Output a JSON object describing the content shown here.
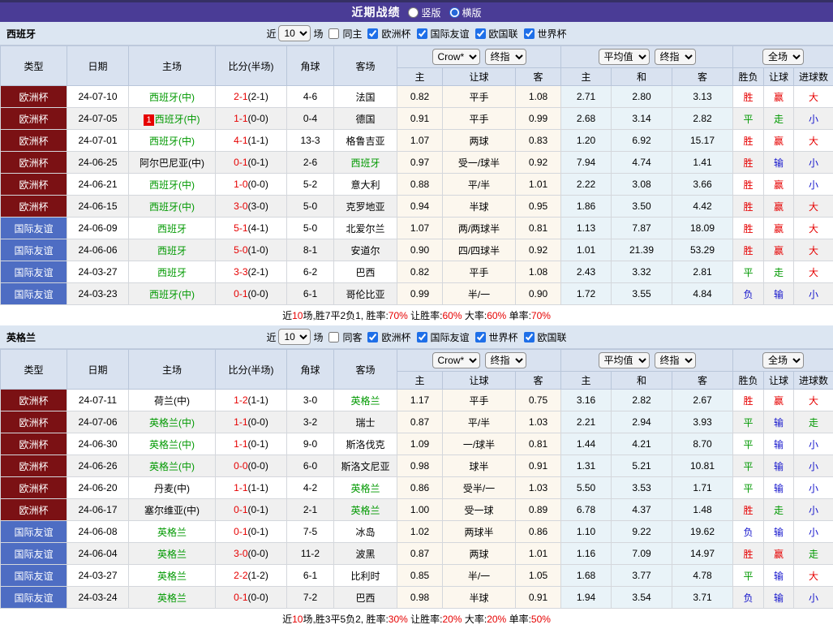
{
  "title_bar": {
    "title": "近期战绩",
    "vertical_label": "竖版",
    "horizontal_label": "横版",
    "selected_layout": "横版"
  },
  "table_header": {
    "main_cols": [
      "类型",
      "日期",
      "主场",
      "比分(半场)",
      "角球",
      "客场"
    ],
    "sub_cols": [
      "主",
      "让球",
      "客",
      "主",
      "和",
      "客",
      "胜负",
      "让球",
      "进球数"
    ],
    "selects": {
      "bookmaker": "Crow*",
      "final_odds_1": "终指",
      "average": "平均值",
      "final_odds_2": "终指",
      "scope": "全场"
    }
  },
  "colors": {
    "titlebar_purple": "#4a3c96",
    "euro_cup_bg": "#7b1114",
    "friendly_bg": "#4e6dc3",
    "win_red": "#e60000",
    "draw_green": "#009900",
    "lose_blue": "#1414cc",
    "crow_cols_bg": "#fcf7ee",
    "avg_cols_bg": "#e9f3f8"
  },
  "sections": [
    {
      "team": "西班牙",
      "filter": {
        "near_label": "近",
        "count": "10",
        "games_label": "场",
        "same_label": "同主",
        "same_checked": false,
        "leagues": [
          "欧洲杯",
          "国际友谊",
          "欧国联",
          "世界杯"
        ]
      },
      "rows": [
        {
          "league": "欧洲杯",
          "lt": "euro",
          "date": "24-07-10",
          "home": "西班牙(中)",
          "hg": 1,
          "badge": "",
          "score": "2-1",
          "half": "(2-1)",
          "corner": "4-6",
          "away": "法国",
          "ag": 0,
          "odds": [
            "0.82",
            "平手",
            "1.08"
          ],
          "avg": [
            "2.71",
            "2.80",
            "3.13"
          ],
          "res": [
            [
              "胜",
              "r"
            ],
            [
              "赢",
              "r"
            ],
            [
              "大",
              "r"
            ]
          ]
        },
        {
          "league": "欧洲杯",
          "lt": "euro",
          "date": "24-07-05",
          "home": "西班牙(中)",
          "hg": 1,
          "badge": "1",
          "score": "1-1",
          "half": "(0-0)",
          "corner": "0-4",
          "away": "德国",
          "ag": 0,
          "odds": [
            "0.91",
            "平手",
            "0.99"
          ],
          "avg": [
            "2.68",
            "3.14",
            "2.82"
          ],
          "res": [
            [
              "平",
              "g"
            ],
            [
              "走",
              "g"
            ],
            [
              "小",
              "b"
            ]
          ]
        },
        {
          "league": "欧洲杯",
          "lt": "euro",
          "date": "24-07-01",
          "home": "西班牙(中)",
          "hg": 1,
          "badge": "",
          "score": "4-1",
          "half": "(1-1)",
          "corner": "13-3",
          "away": "格鲁吉亚",
          "ag": 0,
          "odds": [
            "1.07",
            "两球",
            "0.83"
          ],
          "avg": [
            "1.20",
            "6.92",
            "15.17"
          ],
          "res": [
            [
              "胜",
              "r"
            ],
            [
              "赢",
              "r"
            ],
            [
              "大",
              "r"
            ]
          ]
        },
        {
          "league": "欧洲杯",
          "lt": "euro",
          "date": "24-06-25",
          "home": "阿尔巴尼亚(中)",
          "hg": 0,
          "badge": "",
          "score": "0-1",
          "half": "(0-1)",
          "corner": "2-6",
          "away": "西班牙",
          "ag": 1,
          "odds": [
            "0.97",
            "受一/球半",
            "0.92"
          ],
          "avg": [
            "7.94",
            "4.74",
            "1.41"
          ],
          "res": [
            [
              "胜",
              "r"
            ],
            [
              "输",
              "b"
            ],
            [
              "小",
              "b"
            ]
          ]
        },
        {
          "league": "欧洲杯",
          "lt": "euro",
          "date": "24-06-21",
          "home": "西班牙(中)",
          "hg": 1,
          "badge": "",
          "score": "1-0",
          "half": "(0-0)",
          "corner": "5-2",
          "away": "意大利",
          "ag": 0,
          "odds": [
            "0.88",
            "平/半",
            "1.01"
          ],
          "avg": [
            "2.22",
            "3.08",
            "3.66"
          ],
          "res": [
            [
              "胜",
              "r"
            ],
            [
              "赢",
              "r"
            ],
            [
              "小",
              "b"
            ]
          ]
        },
        {
          "league": "欧洲杯",
          "lt": "euro",
          "date": "24-06-15",
          "home": "西班牙(中)",
          "hg": 1,
          "badge": "",
          "score": "3-0",
          "half": "(3-0)",
          "corner": "5-0",
          "away": "克罗地亚",
          "ag": 0,
          "odds": [
            "0.94",
            "半球",
            "0.95"
          ],
          "avg": [
            "1.86",
            "3.50",
            "4.42"
          ],
          "res": [
            [
              "胜",
              "r"
            ],
            [
              "赢",
              "r"
            ],
            [
              "大",
              "r"
            ]
          ]
        },
        {
          "league": "国际友谊",
          "lt": "friendly",
          "date": "24-06-09",
          "home": "西班牙",
          "hg": 1,
          "badge": "",
          "score": "5-1",
          "half": "(4-1)",
          "corner": "5-0",
          "away": "北爱尔兰",
          "ag": 0,
          "odds": [
            "1.07",
            "两/两球半",
            "0.81"
          ],
          "avg": [
            "1.13",
            "7.87",
            "18.09"
          ],
          "res": [
            [
              "胜",
              "r"
            ],
            [
              "赢",
              "r"
            ],
            [
              "大",
              "r"
            ]
          ]
        },
        {
          "league": "国际友谊",
          "lt": "friendly",
          "date": "24-06-06",
          "home": "西班牙",
          "hg": 1,
          "badge": "",
          "score": "5-0",
          "half": "(1-0)",
          "corner": "8-1",
          "away": "安道尔",
          "ag": 0,
          "odds": [
            "0.90",
            "四/四球半",
            "0.92"
          ],
          "avg": [
            "1.01",
            "21.39",
            "53.29"
          ],
          "res": [
            [
              "胜",
              "r"
            ],
            [
              "赢",
              "r"
            ],
            [
              "大",
              "r"
            ]
          ]
        },
        {
          "league": "国际友谊",
          "lt": "friendly",
          "date": "24-03-27",
          "home": "西班牙",
          "hg": 1,
          "badge": "",
          "score": "3-3",
          "half": "(2-1)",
          "corner": "6-2",
          "away": "巴西",
          "ag": 0,
          "odds": [
            "0.82",
            "平手",
            "1.08"
          ],
          "avg": [
            "2.43",
            "3.32",
            "2.81"
          ],
          "res": [
            [
              "平",
              "g"
            ],
            [
              "走",
              "g"
            ],
            [
              "大",
              "r"
            ]
          ]
        },
        {
          "league": "国际友谊",
          "lt": "friendly",
          "date": "24-03-23",
          "home": "西班牙(中)",
          "hg": 1,
          "badge": "",
          "score": "0-1",
          "half": "(0-0)",
          "corner": "6-1",
          "away": "哥伦比亚",
          "ag": 0,
          "odds": [
            "0.99",
            "半/一",
            "0.90"
          ],
          "avg": [
            "1.72",
            "3.55",
            "4.84"
          ],
          "res": [
            [
              "负",
              "b"
            ],
            [
              "输",
              "b"
            ],
            [
              "小",
              "b"
            ]
          ]
        }
      ],
      "summary": [
        [
          "近",
          "k"
        ],
        [
          "10",
          "r"
        ],
        [
          "场,胜7平2负1, 胜率:",
          "k"
        ],
        [
          "70%",
          "r"
        ],
        [
          " 让胜率:",
          "k"
        ],
        [
          "60%",
          "r"
        ],
        [
          " 大率:",
          "k"
        ],
        [
          "60%",
          "r"
        ],
        [
          " 单率:",
          "k"
        ],
        [
          "70%",
          "r"
        ]
      ]
    },
    {
      "team": "英格兰",
      "filter": {
        "near_label": "近",
        "count": "10",
        "games_label": "场",
        "same_label": "同客",
        "same_checked": false,
        "leagues": [
          "欧洲杯",
          "国际友谊",
          "世界杯",
          "欧国联"
        ]
      },
      "rows": [
        {
          "league": "欧洲杯",
          "lt": "euro",
          "date": "24-07-11",
          "home": "荷兰(中)",
          "hg": 0,
          "badge": "",
          "score": "1-2",
          "half": "(1-1)",
          "corner": "3-0",
          "away": "英格兰",
          "ag": 1,
          "odds": [
            "1.17",
            "平手",
            "0.75"
          ],
          "avg": [
            "3.16",
            "2.82",
            "2.67"
          ],
          "res": [
            [
              "胜",
              "r"
            ],
            [
              "赢",
              "r"
            ],
            [
              "大",
              "r"
            ]
          ]
        },
        {
          "league": "欧洲杯",
          "lt": "euro",
          "date": "24-07-06",
          "home": "英格兰(中)",
          "hg": 1,
          "badge": "",
          "score": "1-1",
          "half": "(0-0)",
          "corner": "3-2",
          "away": "瑞士",
          "ag": 0,
          "odds": [
            "0.87",
            "平/半",
            "1.03"
          ],
          "avg": [
            "2.21",
            "2.94",
            "3.93"
          ],
          "res": [
            [
              "平",
              "g"
            ],
            [
              "输",
              "b"
            ],
            [
              "走",
              "g"
            ]
          ]
        },
        {
          "league": "欧洲杯",
          "lt": "euro",
          "date": "24-06-30",
          "home": "英格兰(中)",
          "hg": 1,
          "badge": "",
          "score": "1-1",
          "half": "(0-1)",
          "corner": "9-0",
          "away": "斯洛伐克",
          "ag": 0,
          "odds": [
            "1.09",
            "一/球半",
            "0.81"
          ],
          "avg": [
            "1.44",
            "4.21",
            "8.70"
          ],
          "res": [
            [
              "平",
              "g"
            ],
            [
              "输",
              "b"
            ],
            [
              "小",
              "b"
            ]
          ]
        },
        {
          "league": "欧洲杯",
          "lt": "euro",
          "date": "24-06-26",
          "home": "英格兰(中)",
          "hg": 1,
          "badge": "",
          "score": "0-0",
          "half": "(0-0)",
          "corner": "6-0",
          "away": "斯洛文尼亚",
          "ag": 0,
          "odds": [
            "0.98",
            "球半",
            "0.91"
          ],
          "avg": [
            "1.31",
            "5.21",
            "10.81"
          ],
          "res": [
            [
              "平",
              "g"
            ],
            [
              "输",
              "b"
            ],
            [
              "小",
              "b"
            ]
          ]
        },
        {
          "league": "欧洲杯",
          "lt": "euro",
          "date": "24-06-20",
          "home": "丹麦(中)",
          "hg": 0,
          "badge": "",
          "score": "1-1",
          "half": "(1-1)",
          "corner": "4-2",
          "away": "英格兰",
          "ag": 1,
          "odds": [
            "0.86",
            "受半/一",
            "1.03"
          ],
          "avg": [
            "5.50",
            "3.53",
            "1.71"
          ],
          "res": [
            [
              "平",
              "g"
            ],
            [
              "输",
              "b"
            ],
            [
              "小",
              "b"
            ]
          ]
        },
        {
          "league": "欧洲杯",
          "lt": "euro",
          "date": "24-06-17",
          "home": "塞尔维亚(中)",
          "hg": 0,
          "badge": "",
          "score": "0-1",
          "half": "(0-1)",
          "corner": "2-1",
          "away": "英格兰",
          "ag": 1,
          "odds": [
            "1.00",
            "受一球",
            "0.89"
          ],
          "avg": [
            "6.78",
            "4.37",
            "1.48"
          ],
          "res": [
            [
              "胜",
              "r"
            ],
            [
              "走",
              "g"
            ],
            [
              "小",
              "b"
            ]
          ]
        },
        {
          "league": "国际友谊",
          "lt": "friendly",
          "date": "24-06-08",
          "home": "英格兰",
          "hg": 1,
          "badge": "",
          "score": "0-1",
          "half": "(0-1)",
          "corner": "7-5",
          "away": "冰岛",
          "ag": 0,
          "odds": [
            "1.02",
            "两球半",
            "0.86"
          ],
          "avg": [
            "1.10",
            "9.22",
            "19.62"
          ],
          "res": [
            [
              "负",
              "b"
            ],
            [
              "输",
              "b"
            ],
            [
              "小",
              "b"
            ]
          ]
        },
        {
          "league": "国际友谊",
          "lt": "friendly",
          "date": "24-06-04",
          "home": "英格兰",
          "hg": 1,
          "badge": "",
          "score": "3-0",
          "half": "(0-0)",
          "corner": "11-2",
          "away": "波黑",
          "ag": 0,
          "odds": [
            "0.87",
            "两球",
            "1.01"
          ],
          "avg": [
            "1.16",
            "7.09",
            "14.97"
          ],
          "res": [
            [
              "胜",
              "r"
            ],
            [
              "赢",
              "r"
            ],
            [
              "走",
              "g"
            ]
          ]
        },
        {
          "league": "国际友谊",
          "lt": "friendly",
          "date": "24-03-27",
          "home": "英格兰",
          "hg": 1,
          "badge": "",
          "score": "2-2",
          "half": "(1-2)",
          "corner": "6-1",
          "away": "比利时",
          "ag": 0,
          "odds": [
            "0.85",
            "半/一",
            "1.05"
          ],
          "avg": [
            "1.68",
            "3.77",
            "4.78"
          ],
          "res": [
            [
              "平",
              "g"
            ],
            [
              "输",
              "b"
            ],
            [
              "大",
              "r"
            ]
          ]
        },
        {
          "league": "国际友谊",
          "lt": "friendly",
          "date": "24-03-24",
          "home": "英格兰",
          "hg": 1,
          "badge": "",
          "score": "0-1",
          "half": "(0-0)",
          "corner": "7-2",
          "away": "巴西",
          "ag": 0,
          "odds": [
            "0.98",
            "半球",
            "0.91"
          ],
          "avg": [
            "1.94",
            "3.54",
            "3.71"
          ],
          "res": [
            [
              "负",
              "b"
            ],
            [
              "输",
              "b"
            ],
            [
              "小",
              "b"
            ]
          ]
        }
      ],
      "summary": [
        [
          "近",
          "k"
        ],
        [
          "10",
          "r"
        ],
        [
          "场,胜3平5负2, 胜率:",
          "k"
        ],
        [
          "30%",
          "r"
        ],
        [
          " 让胜率:",
          "k"
        ],
        [
          "20%",
          "r"
        ],
        [
          " 大率:",
          "k"
        ],
        [
          "20%",
          "r"
        ],
        [
          " 单率:",
          "k"
        ],
        [
          "50%",
          "r"
        ]
      ]
    }
  ]
}
